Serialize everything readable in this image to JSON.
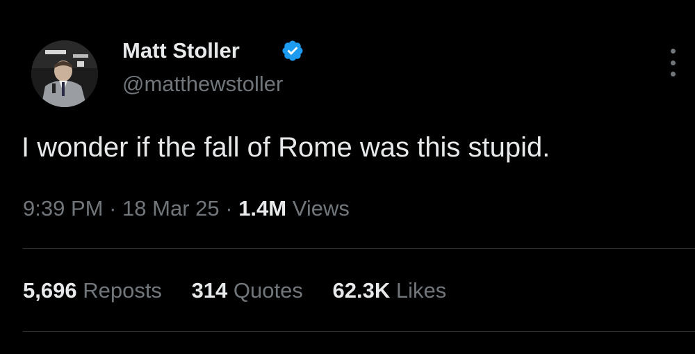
{
  "user": {
    "display_name": "Matt Stoller",
    "handle": "@matthewstoller",
    "verified": true
  },
  "tweet": {
    "text": "I wonder if the fall of Rome was this stupid.",
    "time": "9:39 PM",
    "date": "18 Mar 25",
    "separator": "·",
    "views_count": "1.4M",
    "views_label": "Views"
  },
  "stats": {
    "reposts_count": "5,696",
    "reposts_label": "Reposts",
    "quotes_count": "314",
    "quotes_label": "Quotes",
    "likes_count": "62.3K",
    "likes_label": "Likes"
  },
  "icons": {
    "verified": "verified-badge-icon",
    "more": "more-options-icon"
  },
  "colors": {
    "background": "#000000",
    "primary_text": "#e7e9ea",
    "secondary_text": "#71767b",
    "verified_blue": "#1d9bf0",
    "divider": "#2f3336"
  }
}
